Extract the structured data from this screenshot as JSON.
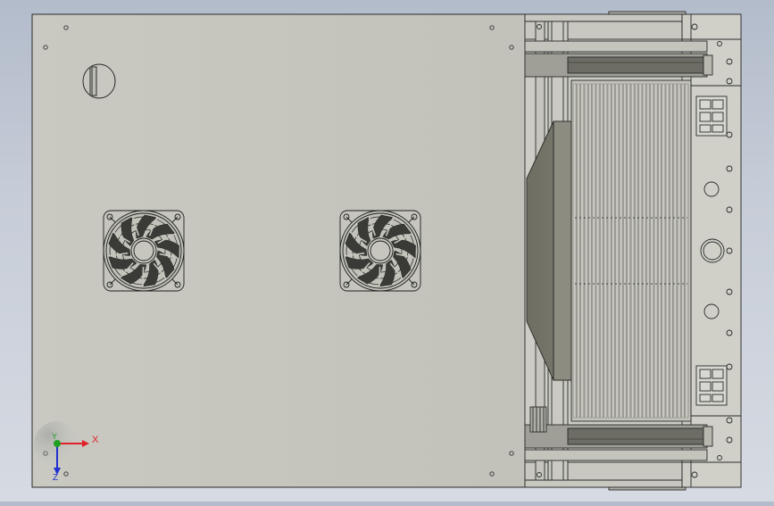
{
  "viewport": {
    "background_top": "#b3bccb",
    "background_bottom": "#d6dae2",
    "model_face_color": "#c4c4bc",
    "edge_color": "#2a2a2a"
  },
  "model": {
    "fans": [
      {
        "id": "fan-left",
        "blades": 9
      },
      {
        "id": "fan-right",
        "blades": 9
      }
    ],
    "rail_slat_count": 30
  },
  "triad": {
    "x_label": "X",
    "y_label": "Y",
    "z_label": "Z",
    "x_color": "#e0202a",
    "y_color": "#20a020",
    "z_color": "#2030d0"
  }
}
